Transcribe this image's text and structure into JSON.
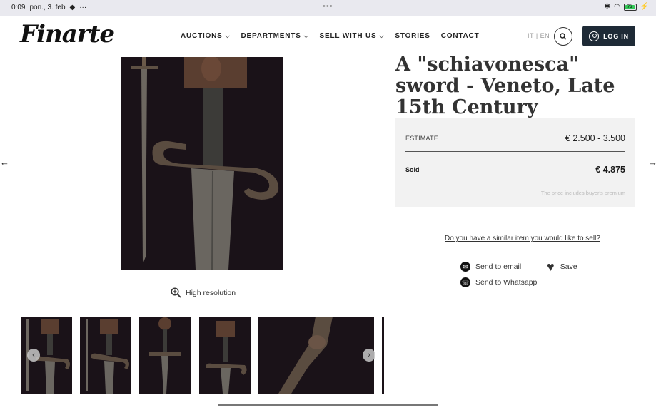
{
  "status_bar": {
    "time": "0:09",
    "date": "pon., 3. feb",
    "dots": "•••",
    "battery_level": "76"
  },
  "header": {
    "logo_text": "Finarte",
    "nav": [
      {
        "label": "AUCTIONS",
        "has_dropdown": true
      },
      {
        "label": "DEPARTMENTS",
        "has_dropdown": true
      },
      {
        "label": "SELL WITH US",
        "has_dropdown": true
      },
      {
        "label": "STORIES",
        "has_dropdown": false
      },
      {
        "label": "CONTACT",
        "has_dropdown": false
      }
    ],
    "lang": "IT | EN",
    "login_label": "LOG IN"
  },
  "gallery": {
    "high_resolution_label": "High resolution",
    "thumbnail_count": 6
  },
  "lot": {
    "title": "A \"schiavonesca\" sword - Veneto, Late 15th Century",
    "estimate_label": "ESTIMATE",
    "estimate_value": "€ 2.500 - 3.500",
    "sold_label": "Sold",
    "sold_value": "€ 4.875",
    "premium_note": "The price includes buyer's premium",
    "sell_link": "Do you have a similar item you would like to sell?",
    "send_email": "Send to email",
    "send_whatsapp": "Send to Whatsapp",
    "save": "Save"
  },
  "colors": {
    "login_bg": "#1e2a36",
    "estimate_box_bg": "#f2f2f2",
    "image_bg": "#1a1218"
  }
}
